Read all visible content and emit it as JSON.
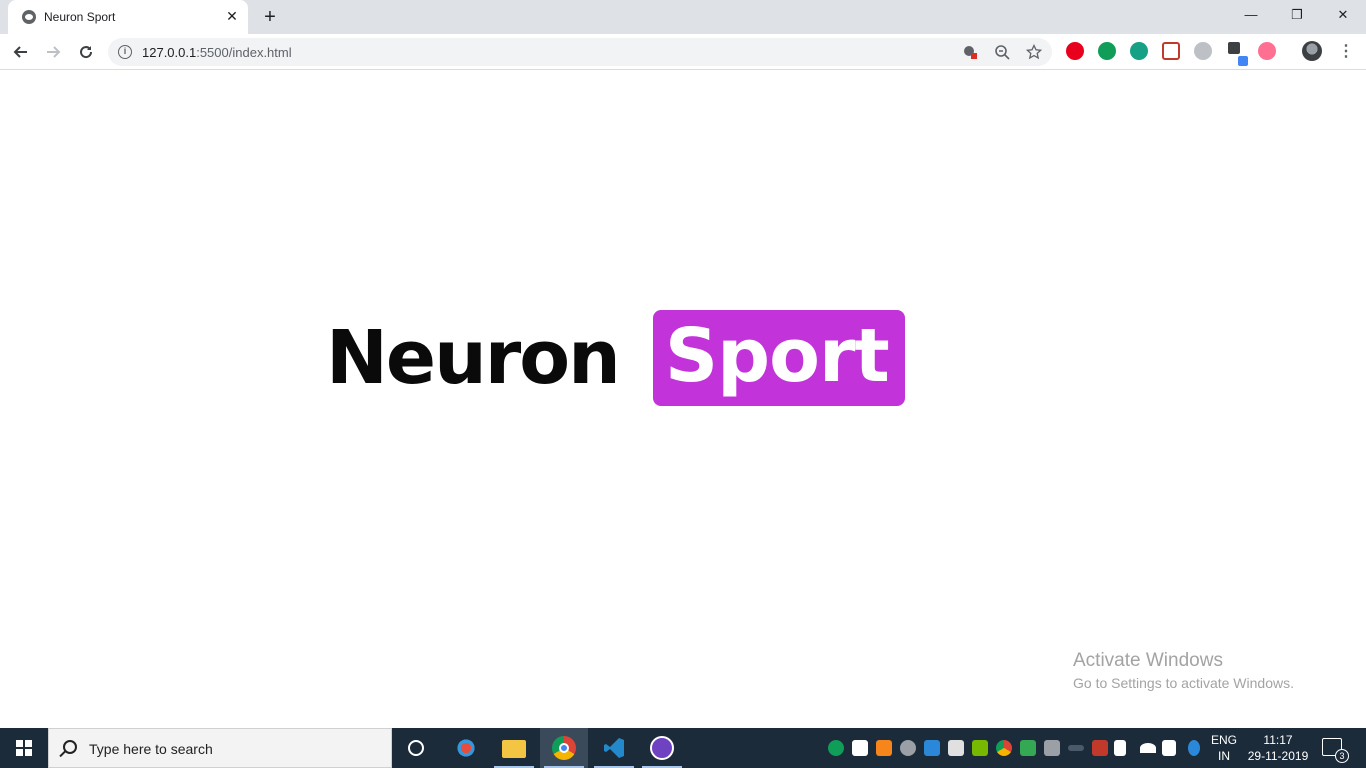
{
  "browser": {
    "tab_title": "Neuron Sport",
    "tab_close": "✕",
    "new_tab": "+",
    "window_controls": {
      "minimize": "—",
      "restore": "❐",
      "close": "✕"
    },
    "url_host": "127.0.0.1",
    "url_path": ":5500/index.html"
  },
  "page": {
    "logo_word1": "Neuron",
    "logo_word2": "Sport",
    "brand_color": "#c233d9"
  },
  "watermark": {
    "line1": "Activate Windows",
    "line2": "Go to Settings to activate Windows."
  },
  "taskbar": {
    "search_placeholder": "Type here to search",
    "language": "ENG",
    "region": "IN",
    "time": "11:17",
    "date": "29-11-2019",
    "notification_count": "3"
  }
}
